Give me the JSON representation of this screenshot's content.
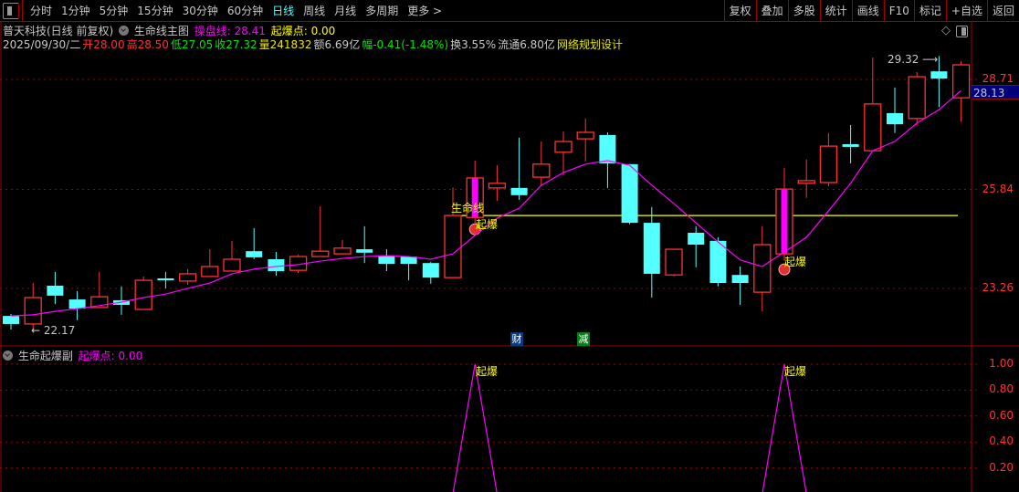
{
  "toolbar": {
    "periods": [
      "分时",
      "1分钟",
      "5分钟",
      "15分钟",
      "30分钟",
      "60分钟",
      "日线",
      "周线",
      "月线",
      "多周期",
      "更多 >"
    ],
    "active_period": "日线",
    "right_buttons": [
      "复权",
      "叠加",
      "多股",
      "统计",
      "画线",
      "F10",
      "标记",
      "+自选",
      "返回"
    ]
  },
  "header": {
    "stock": "普天科技(日线 前复权)",
    "indicator": "生命线主图",
    "cpx_label": "操盘线: 28.41",
    "qbd_label": "起爆点: 0.00",
    "date": "2025/09/30/二",
    "open": "开28.00",
    "high": "高28.50",
    "low": "低27.05",
    "close": "收27.32",
    "volume": "量241832",
    "amount": "额6.69亿",
    "change": "幅-0.41(-1.48%)",
    "turnover": "换3.55%",
    "float": "流通6.80亿",
    "design": "网络规划设计"
  },
  "colors": {
    "up": "#ff3232",
    "down": "#54ffff",
    "line": "#ff00ff",
    "yellow": "#ffff00",
    "grid": "#a00000"
  },
  "price_axis": {
    "labels": [
      "28.71",
      "25.84",
      "23.26"
    ],
    "current": "28.13"
  },
  "annotations": {
    "max": "29.32",
    "min": "22.17",
    "lifeline": "生命线",
    "qibao": "起爆",
    "cai": "财",
    "jian": "减"
  },
  "sub_panel": {
    "title": "生命起爆副",
    "label": "起爆点: 0.00",
    "axis": [
      "1.00",
      "0.80",
      "0.60",
      "0.40",
      "0.20"
    ]
  },
  "chart_data": {
    "type": "candlestick",
    "ohlc": [
      [
        22.54,
        22.33,
        22.59,
        22.19
      ],
      [
        22.33,
        23.02,
        23.4,
        22.17
      ],
      [
        23.33,
        23.07,
        23.69,
        22.85
      ],
      [
        22.97,
        22.73,
        23.19,
        22.43
      ],
      [
        22.76,
        23.04,
        23.69,
        22.76
      ],
      [
        22.95,
        22.83,
        23.31,
        22.57
      ],
      [
        22.71,
        23.47,
        23.57,
        22.71
      ],
      [
        23.52,
        23.47,
        23.69,
        23.26
      ],
      [
        23.45,
        23.64,
        23.76,
        23.35
      ],
      [
        23.57,
        23.83,
        24.28,
        23.57
      ],
      [
        23.71,
        24.02,
        24.5,
        23.71
      ],
      [
        24.23,
        24.07,
        24.83,
        24.02
      ],
      [
        24.02,
        23.71,
        24.21,
        23.59
      ],
      [
        23.73,
        24.09,
        24.14,
        23.66
      ],
      [
        24.09,
        24.23,
        25.4,
        24.09
      ],
      [
        24.16,
        24.31,
        24.52,
        24.16
      ],
      [
        24.28,
        24.19,
        24.88,
        23.92
      ],
      [
        24.12,
        23.9,
        24.28,
        23.71
      ],
      [
        24.09,
        23.9,
        24.09,
        23.47
      ],
      [
        23.92,
        23.54,
        23.95,
        23.38
      ],
      [
        23.54,
        25.16,
        25.88,
        23.54
      ],
      [
        25.11,
        26.14,
        26.59,
        24.95
      ],
      [
        25.88,
        26.0,
        26.47,
        25.54
      ],
      [
        25.88,
        25.69,
        27.19,
        25.57
      ],
      [
        26.16,
        26.5,
        27.09,
        25.92
      ],
      [
        26.81,
        27.09,
        27.35,
        26.21
      ],
      [
        27.16,
        27.33,
        27.69,
        26.57
      ],
      [
        27.26,
        26.52,
        27.33,
        25.88
      ],
      [
        26.5,
        24.97,
        26.5,
        24.93
      ],
      [
        24.97,
        23.64,
        25.38,
        23.02
      ],
      [
        23.61,
        24.28,
        24.28,
        23.57
      ],
      [
        24.71,
        24.4,
        24.88,
        23.81
      ],
      [
        24.5,
        23.4,
        24.59,
        23.31
      ],
      [
        23.61,
        23.4,
        23.83,
        22.83
      ],
      [
        23.16,
        24.4,
        24.88,
        22.66
      ],
      [
        24.16,
        25.85,
        26.4,
        23.99
      ],
      [
        26.0,
        26.07,
        26.62,
        25.62
      ],
      [
        26.02,
        26.97,
        27.31,
        25.92
      ],
      [
        27.02,
        26.95,
        27.52,
        26.52
      ],
      [
        26.85,
        28.07,
        29.28,
        26.85
      ],
      [
        27.83,
        27.54,
        28.5,
        27.31
      ],
      [
        27.69,
        28.78,
        28.9,
        27.52
      ],
      [
        28.92,
        28.73,
        29.32,
        27.99
      ],
      [
        28.23,
        29.09,
        29.19,
        27.61
      ]
    ],
    "lifeline": [
      22.54,
      22.57,
      22.66,
      22.73,
      22.81,
      22.9,
      23.02,
      23.11,
      23.26,
      23.4,
      23.64,
      23.76,
      23.83,
      23.88,
      23.97,
      24.04,
      24.09,
      24.11,
      24.09,
      24.02,
      24.16,
      24.64,
      25.09,
      25.35,
      25.95,
      26.28,
      26.5,
      26.59,
      26.47,
      25.95,
      25.47,
      24.97,
      24.47,
      24.0,
      23.83,
      24.21,
      24.59,
      25.28,
      26.0,
      26.85,
      27.09,
      27.57,
      27.92,
      28.42
    ],
    "operating_line_level": 25.16,
    "operating_line_start": 20,
    "qibao_bars": [
      21,
      35
    ],
    "sub_signal": [
      0,
      0,
      0,
      0,
      0,
      0,
      0,
      0,
      0,
      0,
      0,
      0,
      0,
      0,
      0,
      0,
      0,
      0,
      0,
      0,
      0,
      1,
      0,
      0,
      0,
      0,
      0,
      0,
      0,
      0,
      0,
      0,
      0,
      0,
      0,
      1,
      0,
      0,
      0,
      0,
      0,
      0,
      0,
      0
    ],
    "price_grid": [
      28.71,
      25.84,
      23.26
    ],
    "sub_ylim": [
      0,
      1
    ]
  }
}
